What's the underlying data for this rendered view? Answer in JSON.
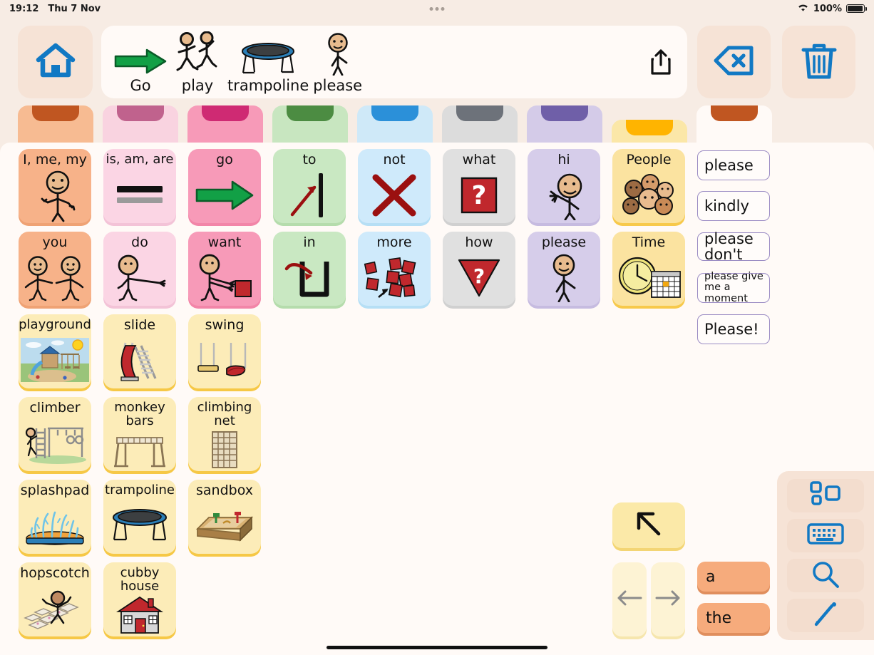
{
  "status_bar": {
    "time": "19:12",
    "date": "Thu 7 Nov",
    "battery_percent": "100%",
    "wifi_icon": "wifi-icon",
    "battery_icon": "battery-icon"
  },
  "toolbar": {
    "home_icon": "home-icon",
    "share_icon": "share-icon",
    "backspace_icon": "backspace-icon",
    "trash_icon": "trash-icon",
    "sentence": [
      {
        "label": "Go",
        "icon": "green-arrow-right-icon"
      },
      {
        "label": "play",
        "icon": "two-figures-running-icon"
      },
      {
        "label": "trampoline",
        "icon": "trampoline-icon"
      },
      {
        "label": "please",
        "icon": "figure-please-icon"
      }
    ]
  },
  "tabs": [
    {
      "name": "pronouns",
      "body": "#f7bb92",
      "notch": "#c05621"
    },
    {
      "name": "verbs-pink",
      "body": "#f9d3e0",
      "notch": "#c0628d"
    },
    {
      "name": "action",
      "body": "#f79ab8",
      "notch": "#cf2a73"
    },
    {
      "name": "prepositions",
      "body": "#c8e6c0",
      "notch": "#4c8c42"
    },
    {
      "name": "descriptors",
      "body": "#cfe9f8",
      "notch": "#2b90d9"
    },
    {
      "name": "questions",
      "body": "#dcdcdc",
      "notch": "#6d727a"
    },
    {
      "name": "social",
      "body": "#d4cbe8",
      "notch": "#6f5fa8"
    },
    {
      "name": "people-time",
      "body": "#fbe7a8",
      "notch": "#ffb400"
    },
    {
      "name": "topic-active",
      "body": "#fffaf7",
      "notch": "#c05621"
    }
  ],
  "grid": {
    "row1": [
      {
        "label": "I, me, my",
        "icon": "figure-pointing-self-icon",
        "bg": "#f7b289",
        "border": "#efa274"
      },
      {
        "label": "is, am, are",
        "icon": "equals-lines-icon",
        "bg": "#fbd5e4",
        "border": "#f3c3d7"
      },
      {
        "label": "go",
        "icon": "green-arrow-right-icon",
        "bg": "#f79ab8",
        "border": "#f285a8"
      },
      {
        "label": "to",
        "icon": "arrow-to-line-icon",
        "bg": "#c9e8c2",
        "border": "#b5dcac"
      },
      {
        "label": "not",
        "icon": "red-x-icon",
        "bg": "#cfeafb",
        "border": "#b6dff5"
      },
      {
        "label": "what",
        "icon": "red-question-square-icon",
        "bg": "#e0e0e0",
        "border": "#d0d0d0"
      },
      {
        "label": "hi",
        "icon": "figure-waving-icon",
        "bg": "#d6cdea",
        "border": "#c6bbe0"
      },
      {
        "label": "People",
        "icon": "group-of-faces-icon",
        "bg": "#fbe3a0",
        "border": "#f7c94b"
      }
    ],
    "row2": [
      {
        "label": "you",
        "icon": "two-figures-pointing-icon",
        "bg": "#f7b289",
        "border": "#efa274"
      },
      {
        "label": "do",
        "icon": "figure-reaching-icon",
        "bg": "#fbd5e4",
        "border": "#f3c3d7"
      },
      {
        "label": "want",
        "icon": "figure-wanting-block-icon",
        "bg": "#f79ab8",
        "border": "#f285a8"
      },
      {
        "label": "in",
        "icon": "arrow-into-container-icon",
        "bg": "#c9e8c2",
        "border": "#b5dcac"
      },
      {
        "label": "more",
        "icon": "red-blocks-pile-icon",
        "bg": "#cfeafb",
        "border": "#b6dff5"
      },
      {
        "label": "how",
        "icon": "red-question-triangle-icon",
        "bg": "#e0e0e0",
        "border": "#d0d0d0"
      },
      {
        "label": "please",
        "icon": "figure-please-icon",
        "bg": "#d6cdea",
        "border": "#c6bbe0"
      },
      {
        "label": "Time",
        "icon": "clock-calendar-icon",
        "bg": "#fbe3a0",
        "border": "#f7c94b"
      }
    ],
    "row3": [
      {
        "label": "playground",
        "icon": "playground-scene-icon",
        "bg": "#fcecb8",
        "border": "#f6c846"
      },
      {
        "label": "slide",
        "icon": "slide-icon",
        "bg": "#fcecb8",
        "border": "#f6c846"
      },
      {
        "label": "swing",
        "icon": "swing-icon",
        "bg": "#fcecb8",
        "border": "#f6c846"
      }
    ],
    "row4": [
      {
        "label": "climber",
        "icon": "climbing-frame-icon",
        "bg": "#fcecb8",
        "border": "#f6c846"
      },
      {
        "label": "monkey bars",
        "icon": "monkey-bars-icon",
        "bg": "#fcecb8",
        "border": "#f6c846"
      },
      {
        "label": "climbing net",
        "icon": "climbing-net-icon",
        "bg": "#fcecb8",
        "border": "#f6c846"
      }
    ],
    "row5": [
      {
        "label": "splashpad",
        "icon": "splashpad-icon",
        "bg": "#fcecb8",
        "border": "#f6c846"
      },
      {
        "label": "trampoline",
        "icon": "trampoline-icon",
        "bg": "#fcecb8",
        "border": "#f6c846"
      },
      {
        "label": "sandbox",
        "icon": "sandbox-icon",
        "bg": "#fcecb8",
        "border": "#f6c846"
      }
    ],
    "row6": [
      {
        "label": "hopscotch",
        "icon": "hopscotch-icon",
        "bg": "#fcecb8",
        "border": "#f6c846"
      },
      {
        "label": "cubby house",
        "icon": "cubby-house-icon",
        "bg": "#fcecb8",
        "border": "#f6c846"
      }
    ]
  },
  "predictions": [
    {
      "text": "please",
      "size": "normal"
    },
    {
      "text": "kindly",
      "size": "normal"
    },
    {
      "text": "please don't",
      "size": "normal"
    },
    {
      "text": "please give\nme a moment",
      "size": "tiny"
    },
    {
      "text": "Please!",
      "size": "normal"
    }
  ],
  "navigation": {
    "back_icon": "arrow-up-left-icon",
    "prev_icon": "arrow-left-icon",
    "next_icon": "arrow-right-icon",
    "word_a": "a",
    "word_the": "the"
  },
  "tool_panel": [
    {
      "name": "boards-icon"
    },
    {
      "name": "keyboard-icon"
    },
    {
      "name": "search-icon"
    },
    {
      "name": "edit-pencil-icon"
    }
  ],
  "colors": {
    "accent_blue": "#1179c4",
    "page_bg": "#f7ece4",
    "board_bg": "#fffaf7",
    "prediction_border": "#9b8cc4",
    "word_button": "#f6ab7c"
  }
}
